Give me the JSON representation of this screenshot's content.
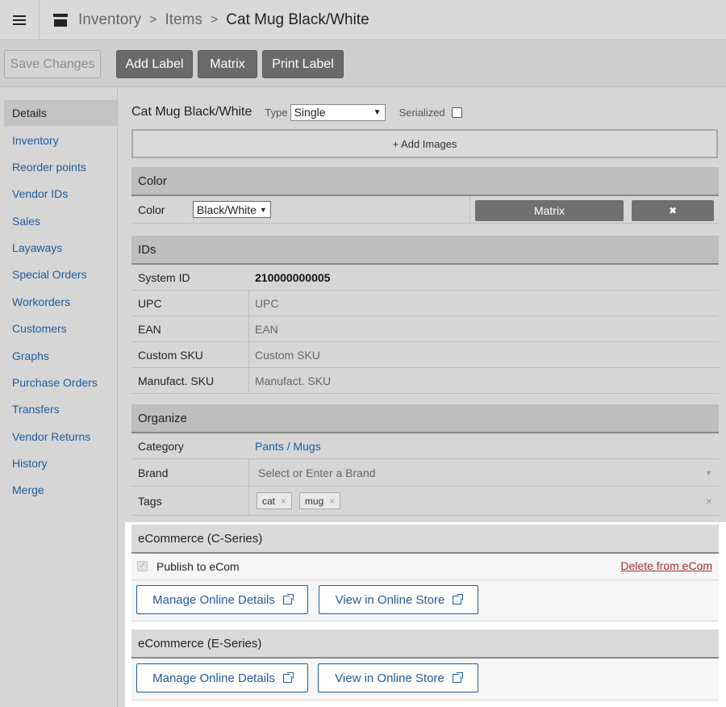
{
  "breadcrumb": {
    "icon": "archive-box-icon",
    "items": [
      "Inventory",
      "Items"
    ],
    "separator": ">",
    "current": "Cat Mug Black/White"
  },
  "toolbar": {
    "save_label": "Save Changes",
    "add_label_label": "Add Label",
    "matrix_label": "Matrix",
    "print_label_label": "Print Label"
  },
  "sidebar": {
    "items": [
      {
        "label": "Details",
        "active": true
      },
      {
        "label": "Inventory"
      },
      {
        "label": "Reorder points"
      },
      {
        "label": "Vendor IDs"
      },
      {
        "label": "Sales"
      },
      {
        "label": "Layaways"
      },
      {
        "label": "Special Orders"
      },
      {
        "label": "Workorders"
      },
      {
        "label": "Customers"
      },
      {
        "label": "Graphs"
      },
      {
        "label": "Purchase Orders"
      },
      {
        "label": "Transfers"
      },
      {
        "label": "Vendor Returns"
      },
      {
        "label": "History"
      },
      {
        "label": "Merge"
      }
    ]
  },
  "item": {
    "name": "Cat Mug Black/White",
    "type_label": "Type",
    "type_value": "Single",
    "serialized_label": "Serialized",
    "add_images_label": "+ Add Images"
  },
  "color_section": {
    "title": "Color",
    "row_label": "Color",
    "value": "Black/White",
    "matrix_button": "Matrix",
    "remove_button": "✖"
  },
  "ids_section": {
    "title": "IDs",
    "rows": [
      {
        "label": "System ID",
        "value": "210000000005"
      },
      {
        "label": "UPC",
        "placeholder": "UPC"
      },
      {
        "label": "EAN",
        "placeholder": "EAN"
      },
      {
        "label": "Custom SKU",
        "placeholder": "Custom SKU"
      },
      {
        "label": "Manufact. SKU",
        "placeholder": "Manufact. SKU"
      }
    ]
  },
  "organize_section": {
    "title": "Organize",
    "category_label": "Category",
    "category_value": "Pants / Mugs",
    "brand_label": "Brand",
    "brand_placeholder": "Select or Enter a Brand",
    "tags_label": "Tags",
    "tags": [
      "cat",
      "mug"
    ],
    "clear_symbol": "×"
  },
  "ecom_c": {
    "title": "eCommerce (C-Series)",
    "publish_label": "Publish to eCom",
    "delete_label": "Delete from eCom",
    "manage_label": "Manage Online Details",
    "view_label": "View in Online Store"
  },
  "ecom_e": {
    "title": "eCommerce (E-Series)",
    "manage_label": "Manage Online Details",
    "view_label": "View in Online Store"
  },
  "colors": {
    "link": "#1f5b99",
    "delete_link": "#a33030",
    "dark_button": "#6a6a6a"
  }
}
